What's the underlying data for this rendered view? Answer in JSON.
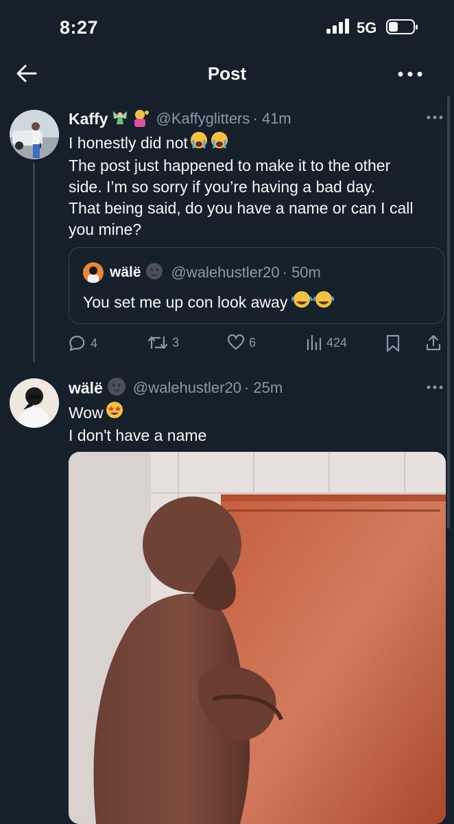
{
  "status_bar": {
    "time": "8:27",
    "network": "5G"
  },
  "header": {
    "title": "Post"
  },
  "tweets": [
    {
      "display_name": "Kaffy",
      "handle": "@Kaffyglitters",
      "time": "· 41m",
      "lines": [
        "I honestly did not",
        "The post just happened to make it to the other",
        "side. I’m so sorry if you’re having a bad day.",
        "That being said, do you have a name or can I call",
        "you mine?"
      ],
      "quote": {
        "display_name": "wälë",
        "handle": "@walehustler20",
        "time": "· 50m",
        "text": "You set me up con look away"
      },
      "actions": {
        "replies": "4",
        "reposts": "3",
        "likes": "6",
        "views": "424"
      }
    },
    {
      "display_name": "wälë",
      "handle": "@walehustler20",
      "time": "· 25m",
      "lines": [
        "Wow",
        "I don't have a name"
      ]
    }
  ],
  "icons": {
    "back": "arrow-left-icon",
    "more": "more-horizontal-icon",
    "reply": "reply-icon",
    "repost": "repost-icon",
    "like": "heart-icon",
    "views": "views-icon",
    "bookmark": "bookmark-icon",
    "share": "share-icon"
  },
  "colors": {
    "background": "#15202b",
    "text": "#f7f9f9",
    "muted": "#8b98a5",
    "border": "#38444d"
  }
}
